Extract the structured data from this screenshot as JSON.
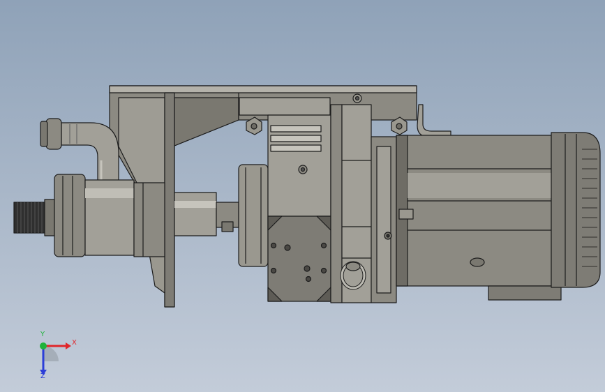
{
  "viewport": {
    "background_top": "#8fa2b8",
    "background_bottom": "#c3ccd9"
  },
  "model": {
    "body_color": "#8c8a82",
    "shade_color": "#6e6c65",
    "light_color": "#b4b2aa",
    "edge_color": "#1c1c1c"
  },
  "triad": {
    "x_label": "X",
    "y_label": "Y",
    "z_label": "Z",
    "x_color": "#e0262a",
    "y_color": "#1fb33a",
    "z_color": "#2c3ed8"
  }
}
